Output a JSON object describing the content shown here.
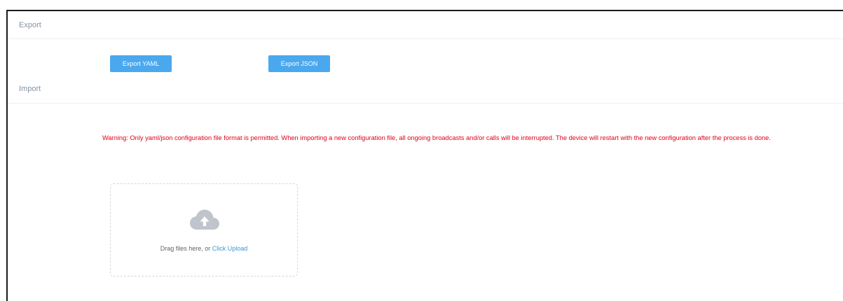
{
  "export": {
    "title": "Export",
    "yaml_button": "Export YAML",
    "json_button": "Export JSON"
  },
  "import": {
    "title": "Import",
    "warning": "Warning: Only yaml/json configuration file format is permitted. When importing a new configuration file, all ongoing broadcasts and/or calls will be interrupted. The device will restart with the new configuration after the process is done.",
    "upload": {
      "icon": "cloud-upload-icon",
      "prompt": "Drag files here, or ",
      "link": "Click Upload"
    }
  },
  "colors": {
    "accent": "#4aa8ee",
    "link": "#3a95d8",
    "warning": "#e0001b",
    "section_title": "#8492a6"
  }
}
